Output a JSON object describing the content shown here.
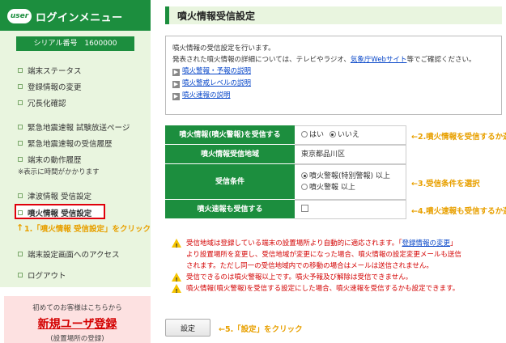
{
  "sidebar": {
    "logo_badge": "user",
    "logo_text": "ログインメニュー",
    "serial_label": "シリアル番号",
    "serial_value": "1600000",
    "items": [
      {
        "label": "端末ステータス"
      },
      {
        "label": "登録情報の変更"
      },
      {
        "label": "冗長化確認"
      },
      {
        "label": "緊急地震速報 試験放送ページ"
      },
      {
        "label": "緊急地震速報の受信履歴"
      },
      {
        "label": "端末の動作履歴"
      },
      {
        "label": "津波情報 受信設定"
      },
      {
        "label": "噴火情報 受信設定"
      },
      {
        "label": "端末設定画面へのアクセス"
      },
      {
        "label": "ログアウト"
      }
    ],
    "note": "※表示に時間がかかります",
    "callout": "1.「噴火情報 受信設定」をクリック",
    "newuser_caption": "初めてのお客様はこちらから",
    "newuser_link": "新規ユーザ登録",
    "newuser_sub": "(設置場所の登録)"
  },
  "main": {
    "title": "噴火情報受信設定",
    "info": {
      "line1": "噴火情報の受信設定を行います。",
      "line2_prefix": "発表された噴火情報の詳細については、テレビやラジオ、",
      "line2_link": "気象庁Webサイト",
      "line2_suffix": "等でご確認ください。",
      "links": [
        "噴火警報・予報の説明",
        "噴火警戒レベルの説明",
        "噴火速報の説明"
      ]
    },
    "rows": {
      "receive_label": "噴火情報(噴火警報)を受信する",
      "receive_yes": "はい",
      "receive_no": "いいえ",
      "area_label": "噴火情報受信地域",
      "area_value": "東京都品川区",
      "condition_label": "受信条件",
      "condition_opt1": "噴火警報(特別警報) 以上",
      "condition_opt2": "噴火警報 以上",
      "quick_label": "噴火速報も受信する"
    },
    "callouts": {
      "c2": "←2.噴火情報を受信するか選択",
      "c3": "←3.受信条件を選択",
      "c4": "←4.噴火速報も受信するか選択",
      "c5": "←5.「設定」をクリック"
    },
    "notes": {
      "n1_a": "受信地域は登録している端末の設置場所より自動的に適応されます。「",
      "n1_link": "登録情報の変更",
      "n1_b": "」",
      "n1_c": "より設置場所を変更し、受信地域が変更になった場合、噴火情報の設定変更メールも送信",
      "n1_d": "されます。ただし同一の受信地域内での移動の場合はメールは送信されません。",
      "n2": "受信できるのは噴火警報以上です。噴火予報及び解除は受信できません。",
      "n3": "噴火情報(噴火警報)を受信する設定にした場合、噴火速報を受信するかも設定できます。"
    },
    "submit_label": "設定"
  },
  "colors": {
    "brand_green": "#1c8e3e",
    "callout_orange": "#e8a000",
    "warning_red": "#d30000"
  }
}
